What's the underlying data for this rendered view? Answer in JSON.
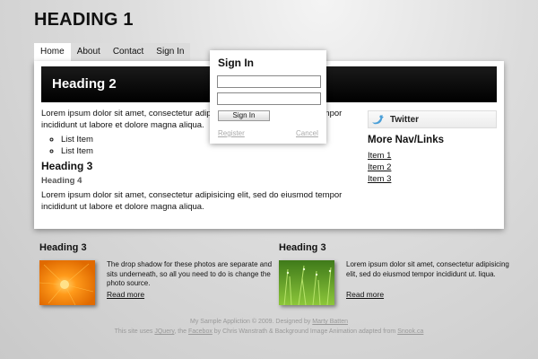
{
  "header": {
    "title": "HEADING 1"
  },
  "nav": {
    "tabs": [
      {
        "label": "Home"
      },
      {
        "label": "About"
      },
      {
        "label": "Contact"
      },
      {
        "label": "Sign In"
      }
    ]
  },
  "banner": {
    "title": "Heading 2"
  },
  "main": {
    "para1": "Lorem ipsum dolor sit amet, consectetur adipisicing elit, sed do eiusmod tempor incididunt ut labore et dolore magna aliqua.",
    "list": [
      "List Item",
      "List Item"
    ],
    "heading3": "Heading 3",
    "heading4": "Heading 4",
    "para2": "Lorem ipsum dolor sit amet, consectetur adipisicing elit, sed do eiusmod tempor incididunt ut labore et dolore magna aliqua."
  },
  "sidebar": {
    "twitter_label": "Twitter",
    "more_nav_title": "More Nav/Links",
    "links": [
      "Item 1",
      "Item 2",
      "Item 3"
    ]
  },
  "signin": {
    "title": "Sign In",
    "username_value": "",
    "password_value": "",
    "button_label": "Sign In",
    "register_label": "Register",
    "cancel_label": "Cancel"
  },
  "features": [
    {
      "heading": "Heading 3",
      "text": "The drop shadow for these photos are separate and sits underneath, so all you need to do is change the photo source.",
      "more": "Read more"
    },
    {
      "heading": "Heading 3",
      "text": "Lorem ipsum dolor sit amet, consectetur adipisicing elit, sed do eiusmod tempor incididunt ut. liqua.",
      "more": "Read more"
    }
  ],
  "footer": {
    "line1_prefix": "My Sample Appliction © 2009. Designed by ",
    "designer": "Marty Batten",
    "line2_prefix": "This site uses ",
    "jquery": "JQuery",
    "line2_mid1": ", the ",
    "facebox": "Facebox",
    "line2_mid2": " by Chris Wanstrath & Background Image Animation adapted from ",
    "snook": "Snook.ca"
  },
  "colors": {
    "banner_bg": "#000000",
    "page_bg": "#d6d6d6",
    "link": "#111111"
  }
}
